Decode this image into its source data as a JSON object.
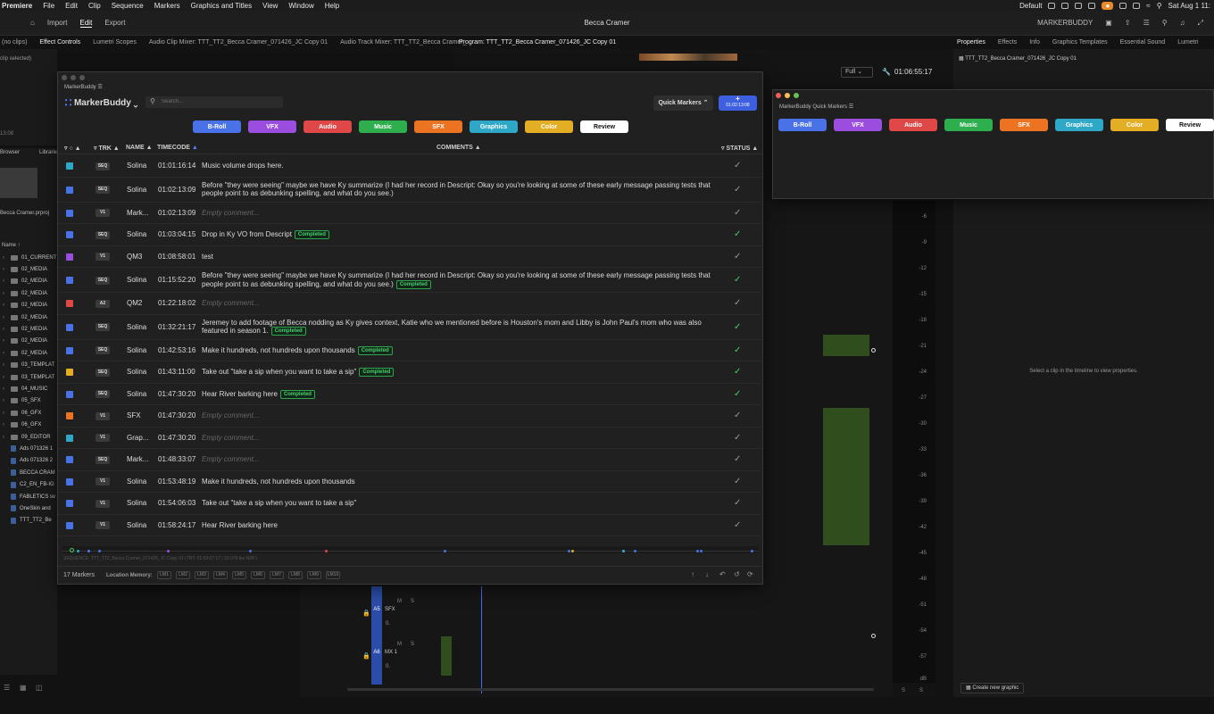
{
  "menubar": {
    "app": "Premiere",
    "items": [
      "File",
      "Edit",
      "Clip",
      "Sequence",
      "Markers",
      "Graphics and Titles",
      "View",
      "Window",
      "Help"
    ],
    "workspace": "Default",
    "clock": "Sat Aug 1  11:"
  },
  "topbar": {
    "import": "Import",
    "edit": "Edit",
    "export": "Export",
    "project_title": "Becca Cramer",
    "workspace_name": "MARKERBUDDY"
  },
  "panels": {
    "left_tabs": [
      "(no clips)",
      "Effect Controls",
      "Lumetri Scopes",
      "Audio Clip Mixer: TTT_TT2_Becca Cramer_071426_JC Copy 01",
      "Audio Track Mixer: TTT_TT2_Becca Cramer_"
    ],
    "program": "Program: TTT_TT2_Becca Cramer_071426_JC Copy 01",
    "right_tabs": [
      "Properties",
      "Effects",
      "Info",
      "Graphics Templates",
      "Essential Sound",
      "Lumetri"
    ],
    "clip_selected": "clip selected)",
    "left_timecode": "13:08",
    "browser_tabs": [
      "Browser",
      "Librarie"
    ],
    "project_file": "Becca Cramer.prproj",
    "name_header": "Name",
    "program_quality": "Full",
    "program_timecode": "01:06:55:17",
    "properties_clip": "TTT_TT2_Becca Cramer_071426_JC Copy 01",
    "properties_hint": "Select a clip in the timeline to view properties.",
    "create_graphic": "Create new graphic"
  },
  "project_tree": [
    {
      "type": "folder",
      "label": "01_CURRENT"
    },
    {
      "type": "folder",
      "label": "02_MEDIA"
    },
    {
      "type": "folder",
      "label": "02_MEDIA"
    },
    {
      "type": "folder",
      "label": "02_MEDIA"
    },
    {
      "type": "folder",
      "label": "02_MEDIA"
    },
    {
      "type": "folder",
      "label": "02_MEDIA"
    },
    {
      "type": "folder",
      "label": "02_MEDIA"
    },
    {
      "type": "folder",
      "label": "02_MEDIA"
    },
    {
      "type": "folder",
      "label": "02_MEDIA"
    },
    {
      "type": "folder",
      "label": "03_TEMPLAT"
    },
    {
      "type": "folder",
      "label": "03_TEMPLAT"
    },
    {
      "type": "folder",
      "label": "04_MUSIC"
    },
    {
      "type": "folder",
      "label": "05_SFX"
    },
    {
      "type": "folder",
      "label": "06_GFX"
    },
    {
      "type": "folder",
      "label": "06_GFX"
    },
    {
      "type": "folder",
      "label": "09_EDITOR"
    },
    {
      "type": "file",
      "label": "Ads 071326 1"
    },
    {
      "type": "file",
      "label": "Ads 071326 2"
    },
    {
      "type": "file",
      "label": "BECCA CRAM"
    },
    {
      "type": "file",
      "label": "C2_EN_FB-IG"
    },
    {
      "type": "file",
      "label": "FABLETICS sv"
    },
    {
      "type": "file",
      "label": "OneSkin and"
    },
    {
      "type": "file",
      "label": "TTT_TT2_Be"
    }
  ],
  "meter_db": [
    "-6",
    "-9",
    "-12",
    "-15",
    "-18",
    "-21",
    "-24",
    "-27",
    "-30",
    "-33",
    "-36",
    "-39",
    "-42",
    "-45",
    "-48",
    "-51",
    "-54",
    "-57",
    "dB"
  ],
  "meter_channels": [
    "S",
    "S"
  ],
  "tracks": {
    "a5": {
      "id": "A5",
      "name": "SFX",
      "vol": "0."
    },
    "a6": {
      "id": "A6",
      "name": "MX 1",
      "vol": "0."
    },
    "msr": [
      "M",
      "S"
    ]
  },
  "markerbuddy": {
    "window_title": "MarkerBuddy",
    "logo": "MarkerBuddy",
    "search_placeholder": "Search...",
    "quick_markers": "Quick Markers",
    "add_timecode": "01:02:13:08",
    "tags": [
      {
        "label": "B-Roll",
        "color": "#4a72e8"
      },
      {
        "label": "VFX",
        "color": "#9b4de0"
      },
      {
        "label": "Audio",
        "color": "#e04848"
      },
      {
        "label": "Music",
        "color": "#2fae4e"
      },
      {
        "label": "SFX",
        "color": "#ec7322"
      },
      {
        "label": "Graphics",
        "color": "#2ea8c6"
      },
      {
        "label": "Color",
        "color": "#e3ad24"
      },
      {
        "label": "Review",
        "color": "#ffffff"
      }
    ],
    "columns": {
      "trk": "TRK",
      "name": "NAME",
      "timecode": "TIMECODE",
      "comments": "COMMENTS",
      "status": "STATUS"
    },
    "completed_label": "Completed",
    "empty_comment": "Empty comment...",
    "rows": [
      {
        "color": "#2ea8c6",
        "trk": "SEQ",
        "name": "Solina",
        "tc": "01:01:16:14",
        "comment": "Music volume drops here.",
        "completed": false,
        "status": "pending"
      },
      {
        "color": "#4a72e8",
        "trk": "SEQ",
        "name": "Solina",
        "tc": "01:02:13:09",
        "comment": "Before \"they were seeing\" maybe we have Ky summarize (I had her record in Descript: Okay so you're looking at some of these early message passing tests that people point to as debunking spelling, and what do you see.)",
        "completed": false,
        "status": "pending"
      },
      {
        "color": "#4a72e8",
        "trk": "V1",
        "name": "Mark...",
        "tc": "01:02:13:09",
        "comment": "",
        "completed": false,
        "status": "pending"
      },
      {
        "color": "#4a72e8",
        "trk": "SEQ",
        "name": "Solina",
        "tc": "01:03:04:15",
        "comment": "Drop in Ky VO from Descript",
        "completed": true,
        "status": "done"
      },
      {
        "color": "#9b4de0",
        "trk": "V1",
        "name": "QM3",
        "tc": "01:08:58:01",
        "comment": "test",
        "completed": false,
        "status": "pending"
      },
      {
        "color": "#4a72e8",
        "trk": "SEQ",
        "name": "Solina",
        "tc": "01:15:52:20",
        "comment": "Before \"they were seeing\" maybe we have Ky summarize (I had her record in Descript: Okay so you're looking at some of these early message passing tests that people point to as debunking spelling, and what do you see.)",
        "completed": true,
        "status": "done"
      },
      {
        "color": "#e04848",
        "trk": "A2",
        "name": "QM2",
        "tc": "01:22:18:02",
        "comment": "",
        "completed": false,
        "status": "pending"
      },
      {
        "color": "#4a72e8",
        "trk": "SEQ",
        "name": "Solina",
        "tc": "01:32:21:17",
        "comment": "Jeremey to add footage of Becca nodding as Ky gives context, Katie who we mentioned before is Houston's mom and Libby is John Paul's mom who was also featured in season 1.",
        "completed": true,
        "status": "done"
      },
      {
        "color": "#4a72e8",
        "trk": "SEQ",
        "name": "Solina",
        "tc": "01:42:53:16",
        "comment": "Make it hundreds, not hundreds upon thousands",
        "completed": true,
        "status": "done"
      },
      {
        "color": "#e3ad24",
        "trk": "SEQ",
        "name": "Solina",
        "tc": "01:43:11:00",
        "comment": "Take out \"take a sip when you want to take a sip\"",
        "completed": true,
        "status": "done"
      },
      {
        "color": "#4a72e8",
        "trk": "SEQ",
        "name": "Solina",
        "tc": "01:47:30:20",
        "comment": "Hear River barking here",
        "completed": true,
        "status": "done"
      },
      {
        "color": "#ec7322",
        "trk": "V1",
        "name": "SFX",
        "tc": "01:47:30:20",
        "comment": "",
        "completed": false,
        "status": "pending"
      },
      {
        "color": "#2ea8c6",
        "trk": "V1",
        "name": "Grap...",
        "tc": "01:47:30:20",
        "comment": "",
        "completed": false,
        "status": "pending"
      },
      {
        "color": "#4a72e8",
        "trk": "SEQ",
        "name": "Mark...",
        "tc": "01:48:33:07",
        "comment": "",
        "completed": false,
        "status": "pending"
      },
      {
        "color": "#4a72e8",
        "trk": "V1",
        "name": "Solina",
        "tc": "01:53:48:19",
        "comment": "Make it hundreds, not hundreds upon thousands",
        "completed": false,
        "status": "pending"
      },
      {
        "color": "#4a72e8",
        "trk": "V1",
        "name": "Solina",
        "tc": "01:54:06:03",
        "comment": "Take out \"take a sip when you want to take a sip\"",
        "completed": false,
        "status": "pending"
      },
      {
        "color": "#4a72e8",
        "trk": "V1",
        "name": "Solina",
        "tc": "01:58:24:17",
        "comment": "Hear River barking here",
        "completed": false,
        "status": "pending"
      }
    ],
    "sequence_info": "SEQUENCE: TTT_TT2_Becca Cramer_071426_JC Copy 01 (TRT: 01:59:07:17 | 23.976 fps NDF)",
    "marker_count": "17 Markers",
    "location_memory_label": "Location Memory:",
    "location_slots": [
      "LM1",
      "LM2",
      "LM3",
      "LM4",
      "LM5",
      "LM6",
      "LM7",
      "LM8",
      "LM9",
      "LM10"
    ]
  },
  "quick_markers": {
    "window_title": "MarkerBuddy Quick Markers"
  },
  "icons": [
    "home-icon",
    "search-icon",
    "plus-icon",
    "filter-icon",
    "check-icon",
    "arrow-up-icon",
    "arrow-down-icon",
    "undo-icon",
    "refresh-icon",
    "wrench-icon",
    "lock-icon",
    "folder-icon"
  ]
}
